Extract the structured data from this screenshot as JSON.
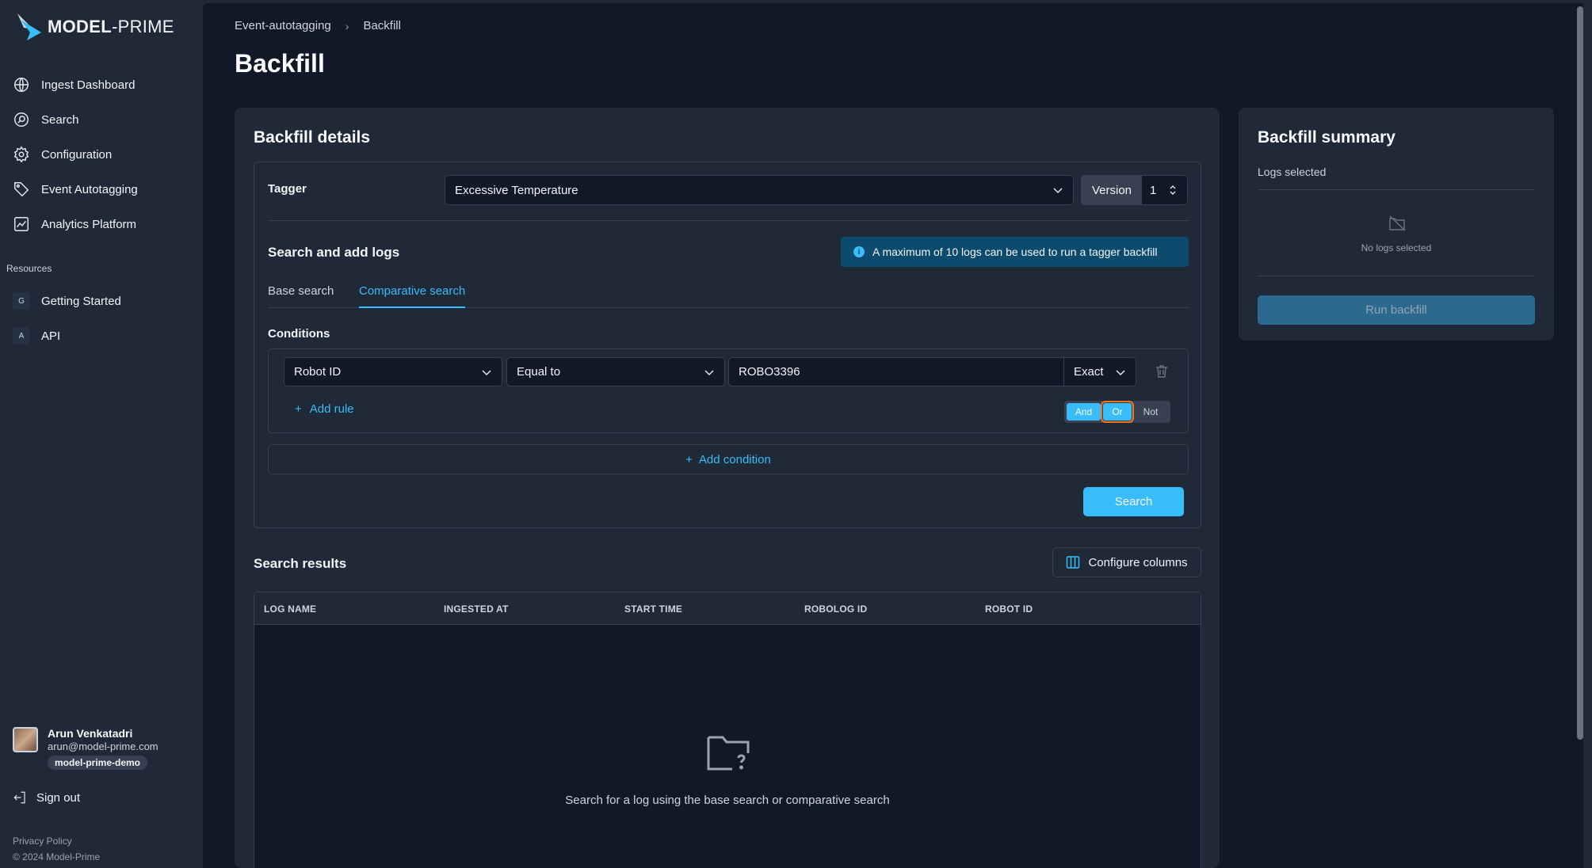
{
  "brand": {
    "name_bold": "MODEL",
    "name_light": "PRIME"
  },
  "sidebar": {
    "items": [
      {
        "label": "Ingest Dashboard",
        "icon": "globe-icon"
      },
      {
        "label": "Search",
        "icon": "search-icon"
      },
      {
        "label": "Configuration",
        "icon": "gear-icon"
      },
      {
        "label": "Event Autotagging",
        "icon": "tag-icon"
      },
      {
        "label": "Analytics Platform",
        "icon": "chart-icon"
      }
    ],
    "resources_label": "Resources",
    "resources": [
      {
        "badge": "G",
        "label": "Getting Started"
      },
      {
        "badge": "A",
        "label": "API"
      }
    ],
    "user": {
      "name": "Arun Venkatadri",
      "email": "arun@model-prime.com",
      "org": "model-prime-demo"
    },
    "signout": "Sign out",
    "privacy": "Privacy Policy",
    "copyright": "© 2024 Model-Prime"
  },
  "breadcrumb": {
    "parent": "Event-autotagging",
    "current": "Backfill"
  },
  "page_title": "Backfill",
  "details": {
    "title": "Backfill details",
    "tagger_label": "Tagger",
    "tagger_value": "Excessive Temperature",
    "version_label": "Version",
    "version_value": "1",
    "search_title": "Search and add logs",
    "info_banner": "A maximum of 10 logs can be used to run a tagger backfill",
    "tabs": [
      "Base search",
      "Comparative search"
    ],
    "active_tab": "Comparative search",
    "conditions_label": "Conditions",
    "rule": {
      "field": "Robot ID",
      "operator": "Equal to",
      "value": "ROBO3396",
      "match": "Exact"
    },
    "add_rule": "Add rule",
    "logic": [
      "And",
      "Or",
      "Not"
    ],
    "logic_selected": "Or",
    "add_condition": "Add condition",
    "search_button": "Search"
  },
  "results": {
    "title": "Search results",
    "configure_columns": "Configure columns",
    "columns": [
      "LOG NAME",
      "INGESTED AT",
      "START TIME",
      "ROBOLOG ID",
      "ROBOT ID"
    ],
    "empty_text": "Search for a log using the base search or comparative search"
  },
  "summary": {
    "title": "Backfill summary",
    "logs_selected_label": "Logs selected",
    "no_logs": "No logs selected",
    "run_button": "Run backfill"
  },
  "colors": {
    "accent": "#38bdf8",
    "background": "#111827",
    "panel": "#1f2937",
    "highlight": "#f97316"
  }
}
